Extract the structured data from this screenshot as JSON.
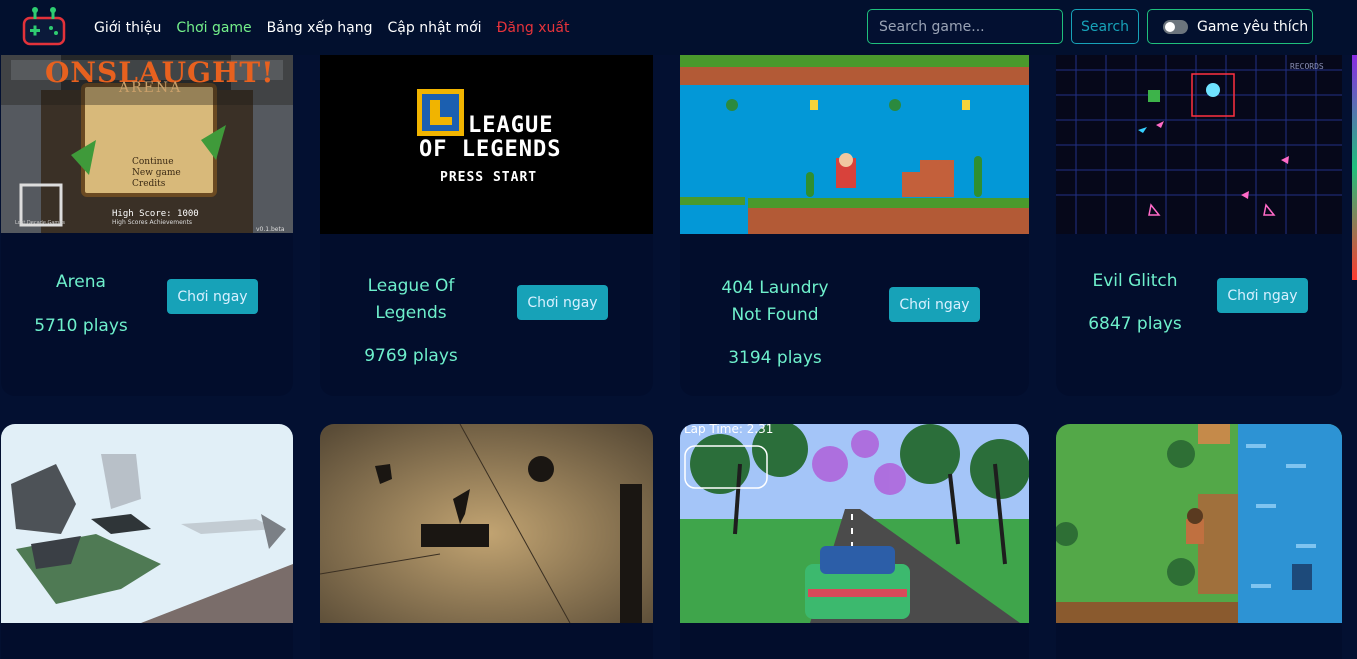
{
  "nav": {
    "links": [
      "Giới thiệu",
      "Chơi game",
      "Bảng xếp hạng",
      "Cập nhật mới",
      "Đăng xuất"
    ],
    "search_placeholder": "Search game...",
    "search_button": "Search",
    "favorite_toggle": "Game yêu thích"
  },
  "play_label": "Chơi ngay",
  "games": [
    {
      "title": "Arena",
      "plays": "5710 plays",
      "thumb_text": {
        "logo": "ONSLAUGHT!",
        "sub": "ARENA",
        "menu": [
          "Continue",
          "New game",
          "Credits"
        ],
        "score": "High Score: 1000",
        "footer": "High Scores   Achievements",
        "version": "v0.1.beta",
        "studio": "Lost Decade Games"
      }
    },
    {
      "title": "League Of Legends",
      "plays": "9769 plays",
      "thumb_text": {
        "line1": "LEAGUE",
        "line2": "OF LEGENDS",
        "press": "PRESS START"
      }
    },
    {
      "title": "404 Laundry Not Found",
      "plays": "3194 plays"
    },
    {
      "title": "Evil Glitch",
      "plays": "6847 plays",
      "thumb_text": {
        "records": "RECORDS"
      }
    },
    {
      "title": "",
      "plays": ""
    },
    {
      "title": "",
      "plays": ""
    },
    {
      "title": "",
      "plays": "",
      "thumb_text": {
        "lap": "Lap Time: 2.31"
      }
    },
    {
      "title": "",
      "plays": ""
    }
  ],
  "colors": {
    "background": "#031031",
    "card": "#020d2c",
    "accent_green": "#74f08a",
    "teal_text": "#6ef0cc",
    "button": "#17a2b8",
    "logout_red": "#e7333b"
  },
  "icons": [
    "gamepad-logo-icon",
    "toggle-switch-icon"
  ]
}
